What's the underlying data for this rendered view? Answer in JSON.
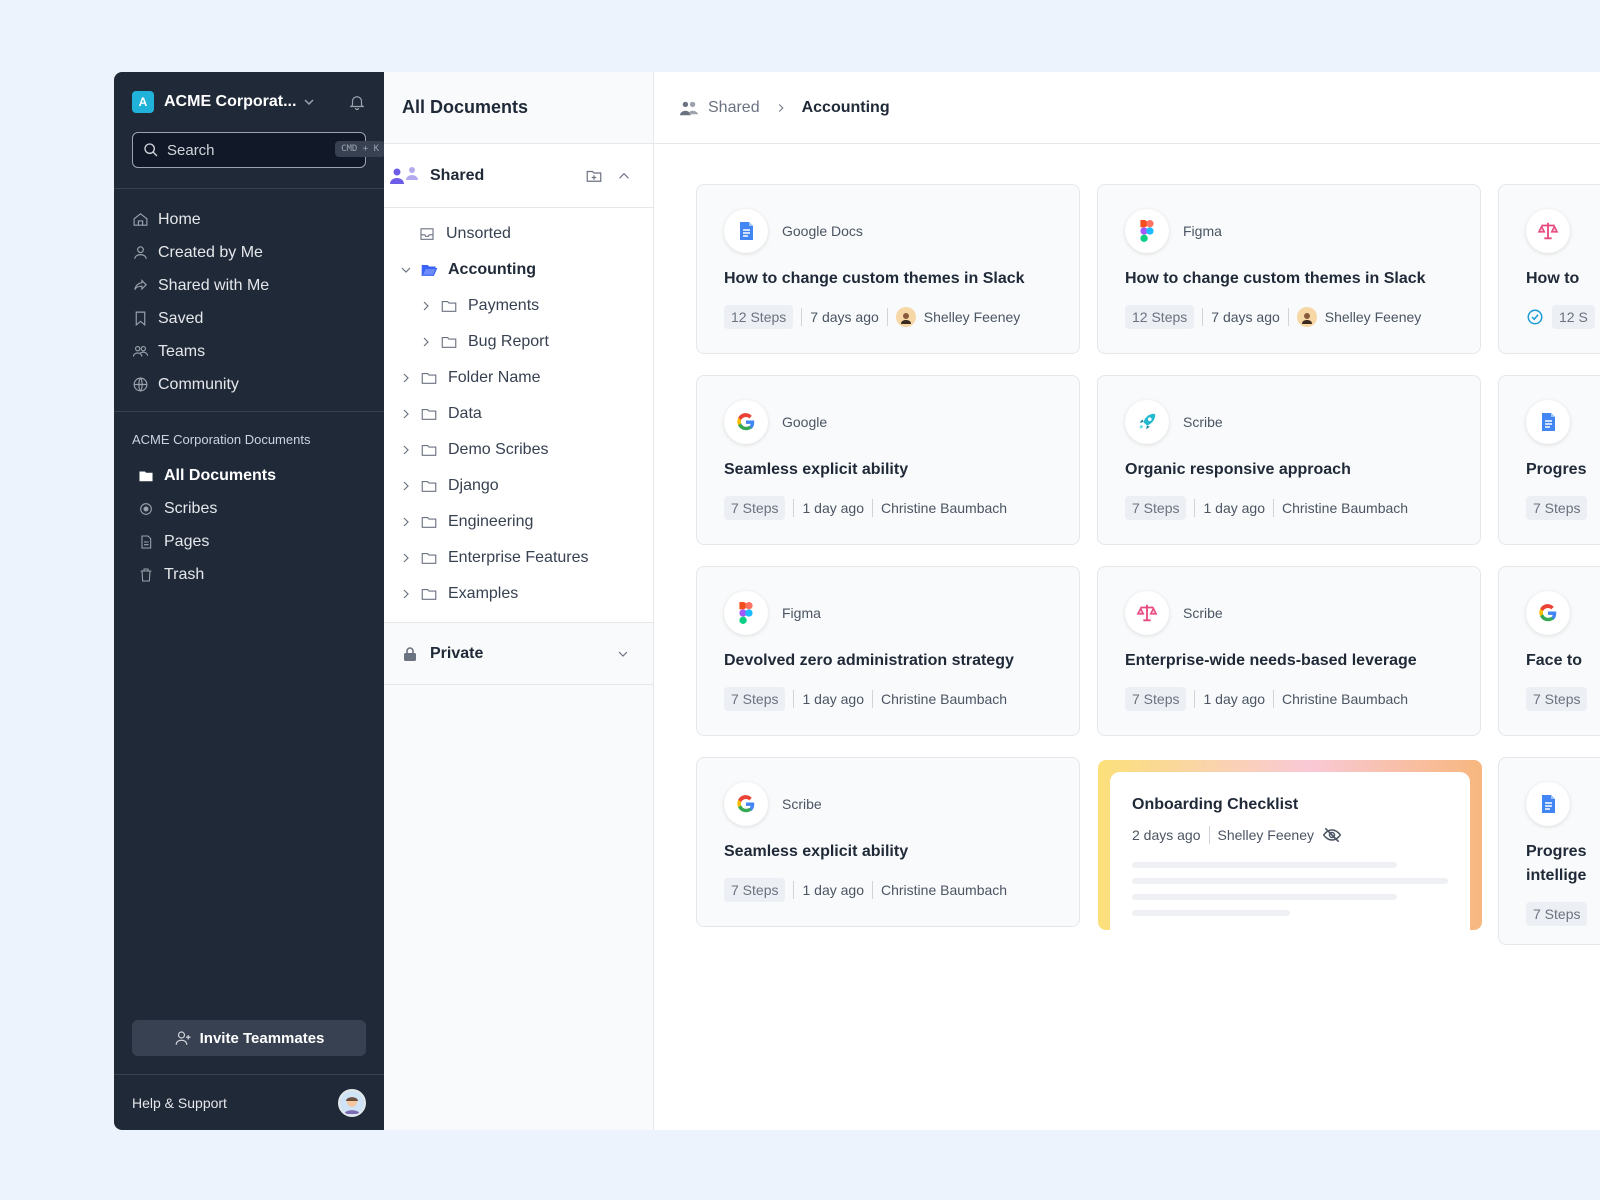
{
  "workspace": {
    "badge": "A",
    "name": "ACME Corporat..."
  },
  "search": {
    "placeholder": "Search",
    "shortcut": "CMD + K"
  },
  "nav": [
    {
      "label": "Home",
      "icon": "home-icon"
    },
    {
      "label": "Created by Me",
      "icon": "user-icon"
    },
    {
      "label": "Shared with Me",
      "icon": "share-icon"
    },
    {
      "label": "Saved",
      "icon": "bookmark-icon"
    },
    {
      "label": "Teams",
      "icon": "team-icon"
    },
    {
      "label": "Community",
      "icon": "globe-icon"
    }
  ],
  "documents": {
    "section_title": "ACME Corporation Documents",
    "items": [
      {
        "label": "All Documents",
        "icon": "folder-icon",
        "active": true
      },
      {
        "label": "Scribes",
        "icon": "scribe-icon"
      },
      {
        "label": "Pages",
        "icon": "page-icon"
      },
      {
        "label": "Trash",
        "icon": "trash-icon"
      }
    ]
  },
  "invite_label": "Invite Teammates",
  "help_label": "Help & Support",
  "folder_panel": {
    "title": "All Documents",
    "shared_label": "Shared",
    "tree": [
      {
        "label": "Unsorted",
        "indent": 1,
        "chevron": "none",
        "icon": "inbox-icon"
      },
      {
        "label": "Accounting",
        "indent": 0,
        "chevron": "down",
        "icon": "open-folder-icon",
        "bold": true
      },
      {
        "label": "Payments",
        "indent": 2,
        "chevron": "right",
        "icon": "folder-icon"
      },
      {
        "label": "Bug Report",
        "indent": 2,
        "chevron": "right",
        "icon": "folder-icon"
      },
      {
        "label": "Folder Name",
        "indent": 0,
        "chevron": "right",
        "icon": "folder-icon"
      },
      {
        "label": "Data",
        "indent": 0,
        "chevron": "right",
        "icon": "folder-icon"
      },
      {
        "label": "Demo Scribes",
        "indent": 0,
        "chevron": "right",
        "icon": "folder-icon"
      },
      {
        "label": "Django",
        "indent": 0,
        "chevron": "right",
        "icon": "folder-icon"
      },
      {
        "label": "Engineering",
        "indent": 0,
        "chevron": "right",
        "icon": "folder-icon"
      },
      {
        "label": "Enterprise Features",
        "indent": 0,
        "chevron": "right",
        "icon": "folder-icon"
      },
      {
        "label": "Examples",
        "indent": 0,
        "chevron": "right",
        "icon": "folder-icon"
      }
    ],
    "private_label": "Private"
  },
  "breadcrumb": {
    "root": "Shared",
    "current": "Accounting"
  },
  "cards": [
    {
      "logo": "gdocs",
      "source": "Google Docs",
      "title": "How to change custom themes in Slack",
      "steps": "12 Steps",
      "time": "7 days ago",
      "author": "Shelley Feeney",
      "avatar": true
    },
    {
      "logo": "figma",
      "source": "Figma",
      "title": "How to change custom themes in Slack",
      "steps": "12 Steps",
      "time": "7 days ago",
      "author": "Shelley Feeney",
      "avatar": true
    },
    {
      "logo": "scales",
      "source": "",
      "title": "How to",
      "steps": "12 S",
      "time": "",
      "author": "",
      "check": true
    },
    {
      "logo": "google",
      "source": "Google",
      "title": "Seamless explicit ability",
      "steps": "7 Steps",
      "time": "1 day ago",
      "author": "Christine Baumbach"
    },
    {
      "logo": "rocket",
      "source": "Scribe",
      "title": "Organic responsive approach",
      "steps": "7 Steps",
      "time": "1 day ago",
      "author": "Christine Baumbach"
    },
    {
      "logo": "gdocs",
      "source": "",
      "title": "Progres",
      "steps": "7 Steps",
      "time": "",
      "author": ""
    },
    {
      "logo": "figma",
      "source": "Figma",
      "title": "Devolved zero administration strategy",
      "steps": "7 Steps",
      "time": "1 day ago",
      "author": "Christine Baumbach"
    },
    {
      "logo": "scales",
      "source": "Scribe",
      "title": "Enterprise-wide needs-based leverage",
      "steps": "7 Steps",
      "time": "1 day ago",
      "author": "Christine Baumbach"
    },
    {
      "logo": "google",
      "source": "",
      "title": "Face to",
      "steps": "7 Steps",
      "time": "",
      "author": ""
    },
    {
      "logo": "google",
      "source": "Scribe",
      "title": "Seamless explicit ability",
      "steps": "7 Steps",
      "time": "1 day ago",
      "author": "Christine Baumbach"
    },
    {
      "logo": "gdocs",
      "source": "",
      "title": "Progres\nintellige",
      "steps": "7 Steps",
      "time": "",
      "author": ""
    }
  ],
  "onboarding": {
    "title": "Onboarding Checklist",
    "time": "2 days ago",
    "author": "Shelley Feeney"
  },
  "colors": {
    "sidebar": "#1f2937",
    "accent": "#20b2d8",
    "page_bg": "#edf3fc"
  }
}
